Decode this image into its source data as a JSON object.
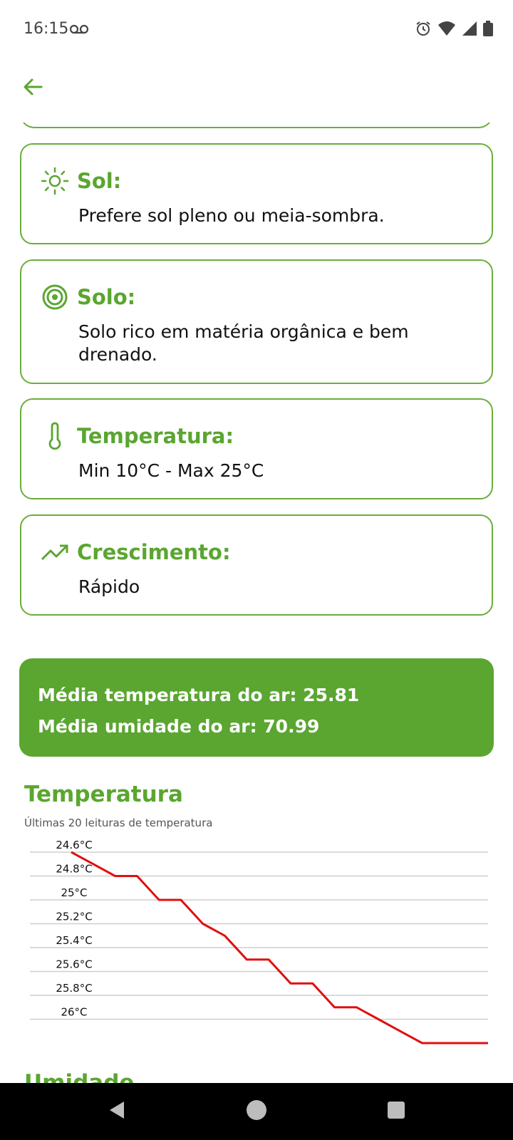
{
  "status_bar": {
    "time": "16:15",
    "icons": [
      "voicemail-icon",
      "alarm-icon",
      "wifi-icon",
      "signal-icon",
      "battery-icon"
    ]
  },
  "app_bar": {
    "back_icon": "arrow-left-icon"
  },
  "cards": [
    {
      "icon": "sun-icon",
      "title": "Sol:",
      "text": "Prefere sol pleno ou meia-sombra."
    },
    {
      "icon": "target-icon",
      "title": "Solo:",
      "text": "Solo rico em matéria orgânica e bem drenado."
    },
    {
      "icon": "thermometer-icon",
      "title": "Temperatura:",
      "text": "Min 10°C - Max 25°C"
    },
    {
      "icon": "trending-up-icon",
      "title": "Crescimento:",
      "text": "Rápido"
    }
  ],
  "averages": {
    "temperature": "Média temperatura do ar: 25.81",
    "humidity": "Média umidade do ar: 70.99"
  },
  "chart_section": {
    "title": "Temperatura",
    "subtitle": "Últimas 20 leituras de temperatura"
  },
  "chart_data": {
    "type": "line",
    "y_tick_labels": [
      "24.6°C",
      "24.8°C",
      "25°C",
      "25.2°C",
      "25.4°C",
      "25.6°C",
      "25.8°C",
      "26°C"
    ],
    "y_ticks": [
      24.6,
      24.8,
      25.0,
      25.2,
      25.4,
      25.6,
      25.8,
      26.0
    ],
    "ylim": [
      24.6,
      26.0
    ],
    "y_inverted": true,
    "grid": true,
    "series": [
      {
        "color": "#e01010",
        "values": [
          24.6,
          24.7,
          24.8,
          24.8,
          25.0,
          25.0,
          25.2,
          25.3,
          25.5,
          25.5,
          25.7,
          25.7,
          25.9,
          25.9,
          26.0,
          26.1,
          26.2,
          26.2,
          26.2,
          26.2
        ]
      }
    ]
  },
  "next_section": {
    "title": "Umidade"
  },
  "nav_bar": {
    "icons": [
      "back-triangle-icon",
      "home-circle-icon",
      "recents-square-icon"
    ]
  },
  "colors": {
    "accent": "#5aa630",
    "border": "#6aae3a",
    "line": "#e01010"
  }
}
